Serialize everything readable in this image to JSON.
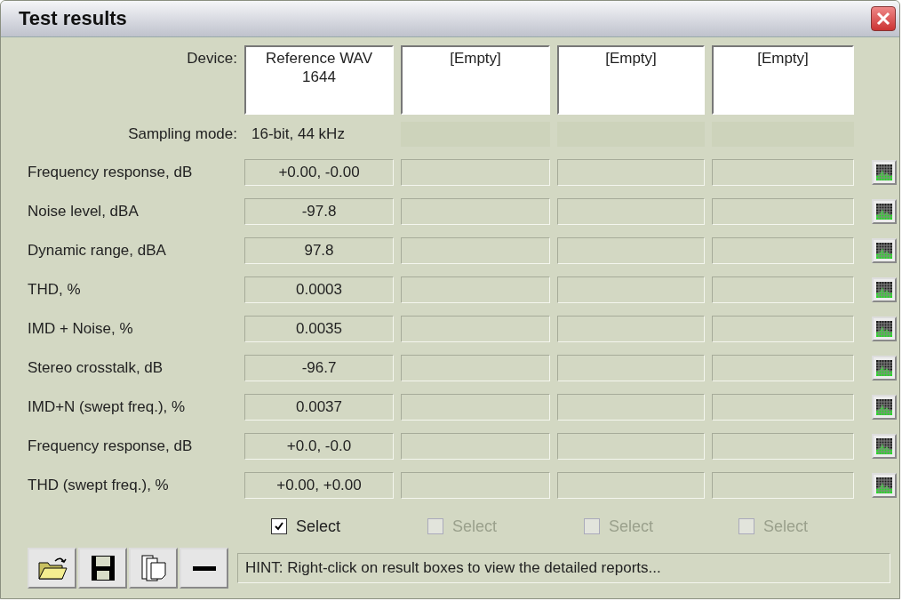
{
  "window": {
    "title": "Test results"
  },
  "device_label": "Device:",
  "devices": [
    {
      "name": "Reference WAV 1644",
      "sampling_mode": "16-bit, 44 kHz",
      "select_label": "Select",
      "checked": true,
      "disabled": false
    },
    {
      "name": "[Empty]",
      "select_label": "Select",
      "checked": false,
      "disabled": true
    },
    {
      "name": "[Empty]",
      "select_label": "Select",
      "checked": false,
      "disabled": true
    },
    {
      "name": "[Empty]",
      "select_label": "Select",
      "checked": false,
      "disabled": true
    }
  ],
  "sampling_label": "Sampling mode:",
  "results": [
    {
      "label": "Frequency response, dB",
      "values": [
        "+0.00, -0.00"
      ]
    },
    {
      "label": "Noise level, dBA",
      "values": [
        "-97.8"
      ]
    },
    {
      "label": "Dynamic range, dBA",
      "values": [
        "97.8"
      ]
    },
    {
      "label": "THD, %",
      "values": [
        "0.0003"
      ]
    },
    {
      "label": "IMD + Noise, %",
      "values": [
        "0.0035"
      ]
    },
    {
      "label": "Stereo crosstalk, dB",
      "values": [
        "-96.7"
      ]
    },
    {
      "label": "IMD+N (swept freq.), %",
      "values": [
        "0.0037"
      ]
    },
    {
      "label": "Frequency response, dB",
      "values": [
        "+0.0, -0.0"
      ]
    },
    {
      "label": "THD (swept freq.), %",
      "values": [
        "+0.00, +0.00"
      ]
    }
  ],
  "hint": "HINT: Right-click on result boxes to view the detailed reports..."
}
